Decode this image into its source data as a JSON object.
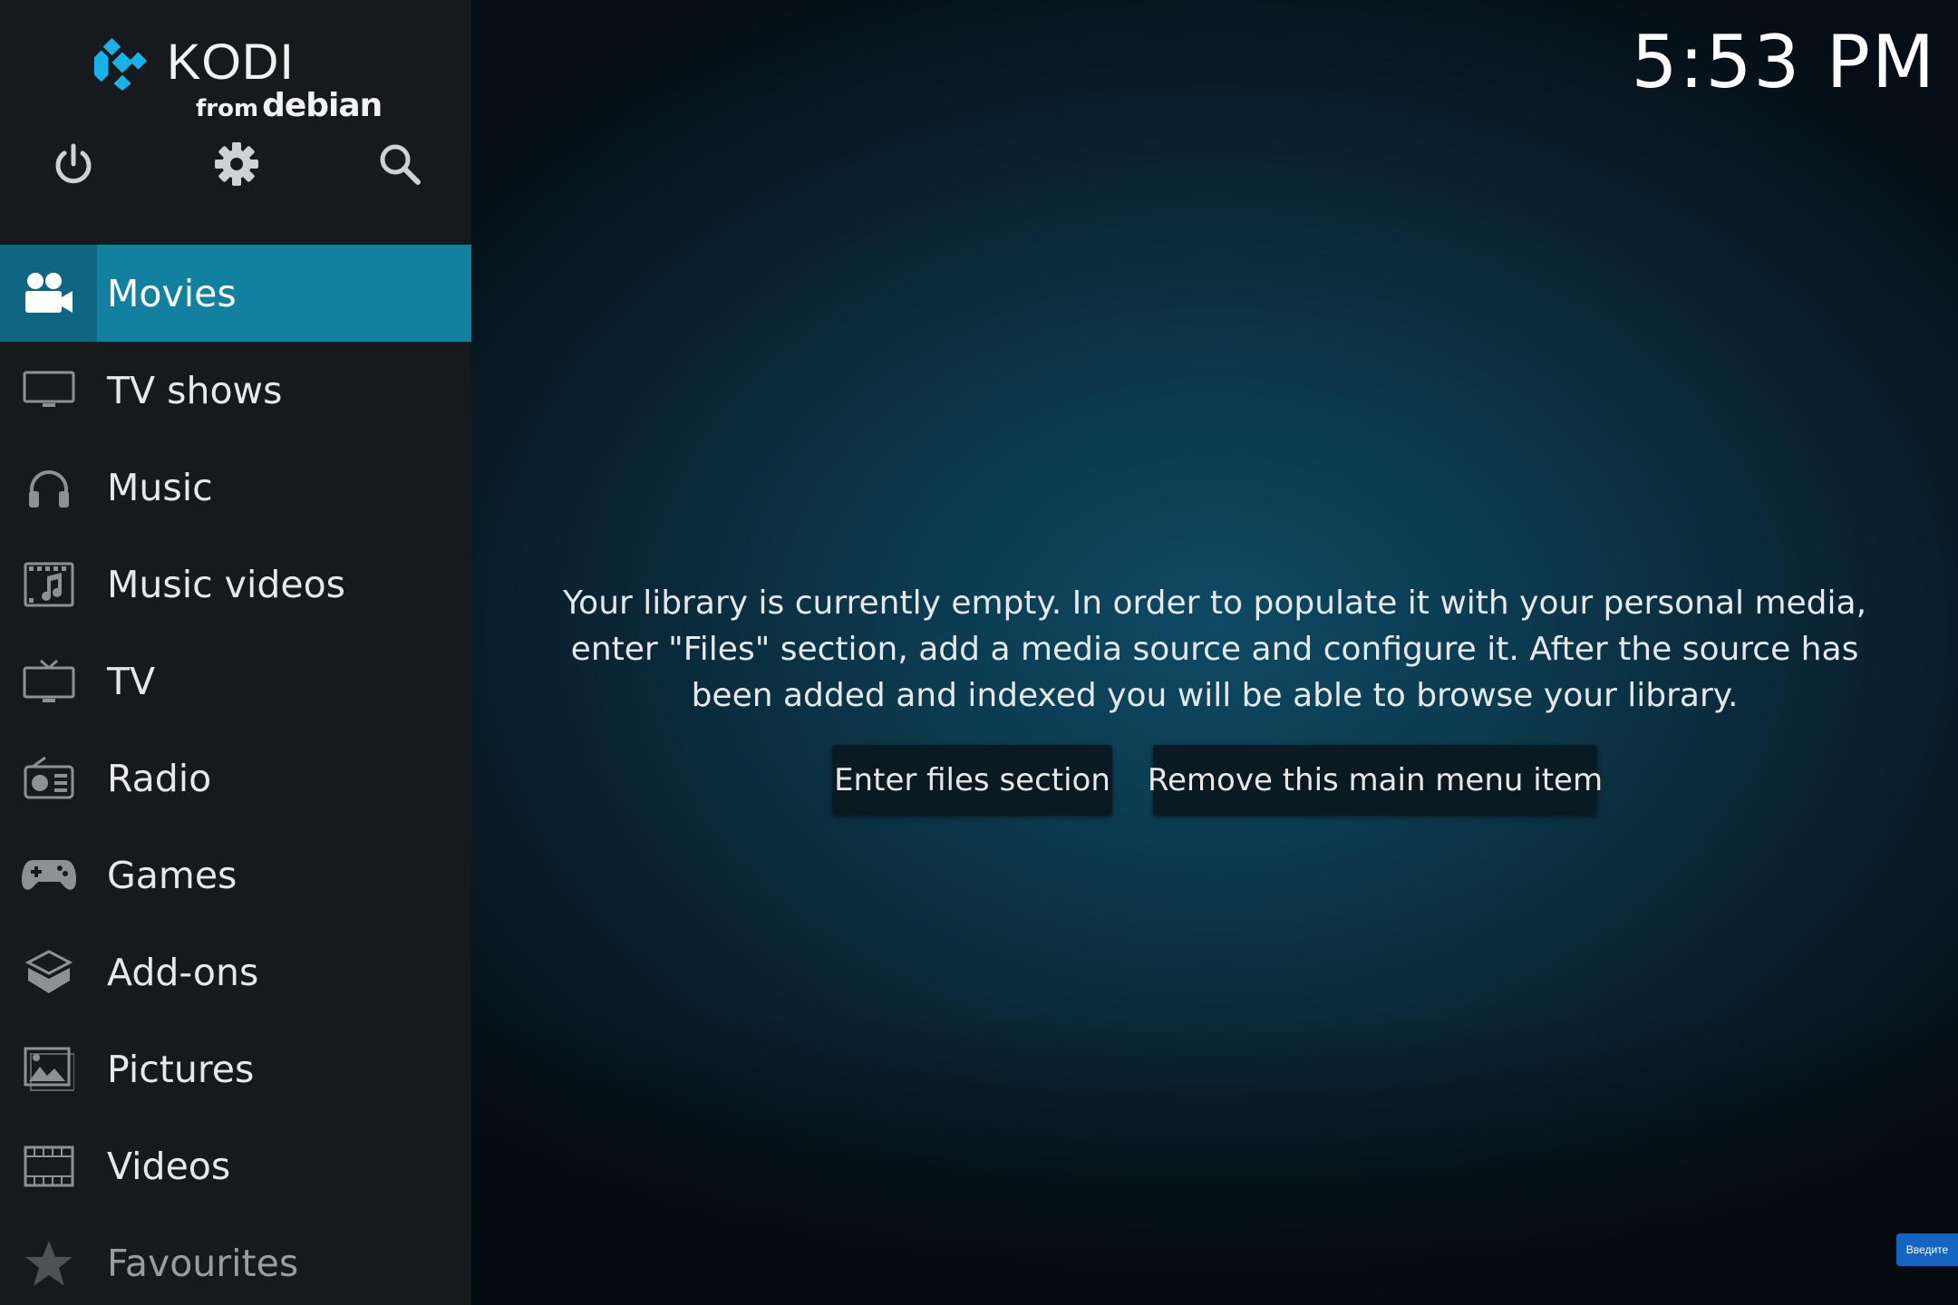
{
  "branding": {
    "name": "KODI",
    "from": "from",
    "distro": "debian"
  },
  "topbar": {
    "power_icon": "power-icon",
    "settings_icon": "gear-icon",
    "search_icon": "search-icon"
  },
  "clock": "5:53 PM",
  "menu": [
    {
      "label": "Movies",
      "icon": "movies-icon",
      "active": true
    },
    {
      "label": "TV shows",
      "icon": "tv-shows-icon"
    },
    {
      "label": "Music",
      "icon": "headphones-icon"
    },
    {
      "label": "Music videos",
      "icon": "music-videos-icon"
    },
    {
      "label": "TV",
      "icon": "tv-icon"
    },
    {
      "label": "Radio",
      "icon": "radio-icon"
    },
    {
      "label": "Games",
      "icon": "gamepad-icon"
    },
    {
      "label": "Add-ons",
      "icon": "addons-icon"
    },
    {
      "label": "Pictures",
      "icon": "pictures-icon"
    },
    {
      "label": "Videos",
      "icon": "film-icon"
    },
    {
      "label": "Favourites",
      "icon": "star-icon"
    }
  ],
  "main": {
    "message": "Your library is currently empty. In order to populate it with your personal media, enter \"Files\" section, add a media source and configure it. After the source has been added and indexed you will be able to browse your library.",
    "enter_files_label": "Enter files section",
    "remove_item_label": "Remove this main menu item"
  },
  "ime_indicator": "Введите",
  "colors": {
    "accent": "#12809f",
    "accent_dark": "#0e6683",
    "sidebar_bg": "#171a1d",
    "kodi_blue": "#17b2e7"
  }
}
